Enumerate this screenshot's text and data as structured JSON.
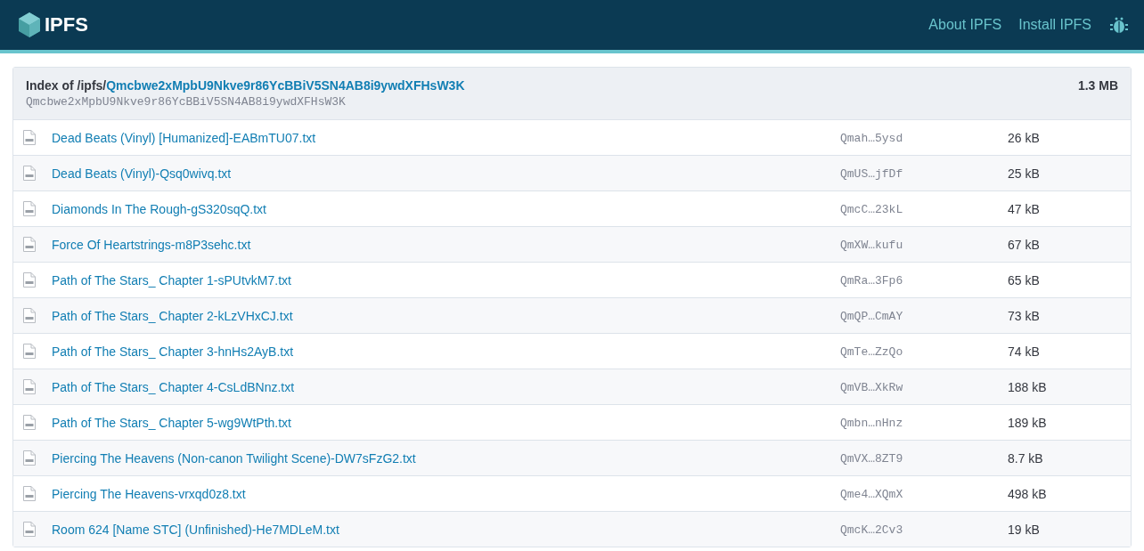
{
  "header": {
    "logo_text": "IPFS",
    "links": [
      "About IPFS",
      "Install IPFS"
    ]
  },
  "index": {
    "title_prefix": "Index of /ipfs/",
    "title_link": "Qmcbwe2xMpbU9Nkve9r86YcBBiV5SN4AB8i9ywdXFHsW3K",
    "hash": "Qmcbwe2xMpbU9Nkve9r86YcBBiV5SN4AB8i9ywdXFHsW3K",
    "size": "1.3 MB"
  },
  "files": [
    {
      "name": "Dead Beats (Vinyl) [Humanized]-EABmTU07.txt",
      "hash": "Qmah…5ysd",
      "size": "26 kB"
    },
    {
      "name": "Dead Beats (Vinyl)-Qsq0wivq.txt",
      "hash": "QmUS…jfDf",
      "size": "25 kB"
    },
    {
      "name": "Diamonds In The Rough-gS320sqQ.txt",
      "hash": "QmcC…23kL",
      "size": "47 kB"
    },
    {
      "name": "Force Of Heartstrings-m8P3sehc.txt",
      "hash": "QmXW…kufu",
      "size": "67 kB"
    },
    {
      "name": "Path of The Stars_ Chapter 1-sPUtvkM7.txt",
      "hash": "QmRa…3Fp6",
      "size": "65 kB"
    },
    {
      "name": "Path of The Stars_ Chapter 2-kLzVHxCJ.txt",
      "hash": "QmQP…CmAY",
      "size": "73 kB"
    },
    {
      "name": "Path of The Stars_ Chapter 3-hnHs2AyB.txt",
      "hash": "QmTe…ZzQo",
      "size": "74 kB"
    },
    {
      "name": "Path of The Stars_ Chapter 4-CsLdBNnz.txt",
      "hash": "QmVB…XkRw",
      "size": "188 kB"
    },
    {
      "name": "Path of The Stars_ Chapter 5-wg9WtPth.txt",
      "hash": "Qmbn…nHnz",
      "size": "189 kB"
    },
    {
      "name": "Piercing The Heavens (Non-canon Twilight Scene)-DW7sFzG2.txt",
      "hash": "QmVX…8ZT9",
      "size": "8.7 kB"
    },
    {
      "name": "Piercing The Heavens-vrxqd0z8.txt",
      "hash": "Qme4…XQmX",
      "size": "498 kB"
    },
    {
      "name": "Room 624 [Name STC] (Unfinished)-He7MDLeM.txt",
      "hash": "QmcK…2Cv3",
      "size": "19 kB"
    }
  ]
}
